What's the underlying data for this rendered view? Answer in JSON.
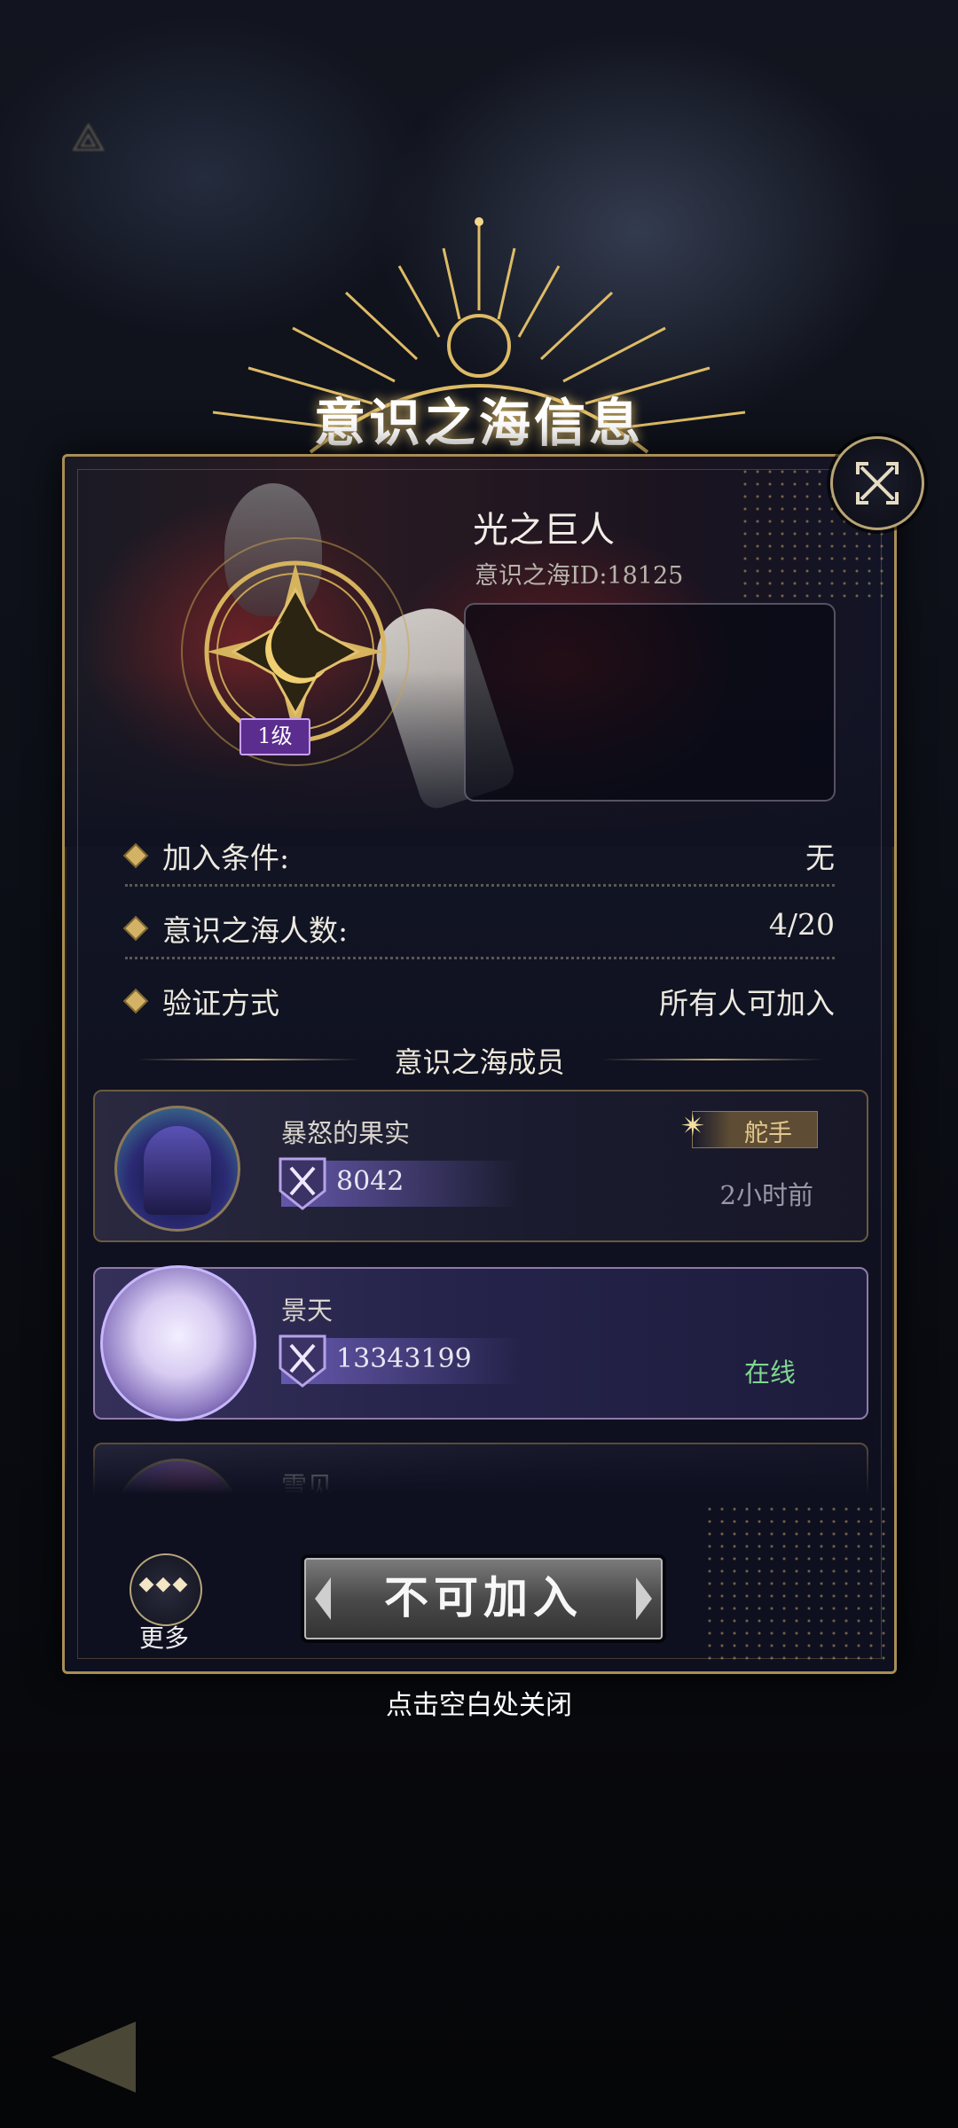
{
  "background": {
    "title_text": ""
  },
  "panel": {
    "title": "意识之海信息",
    "sea_name": "光之巨人",
    "sea_id": "意识之海ID:18125",
    "level_badge": "1级",
    "info": [
      {
        "label": "加入条件:",
        "value": "无"
      },
      {
        "label": "意识之海人数:",
        "value": "4/20"
      },
      {
        "label": "验证方式",
        "value": "所有人可加入"
      }
    ],
    "members_section_title": "意识之海成员",
    "members": [
      {
        "name": "暴怒的果实",
        "power": "8042",
        "status": "2小时前",
        "role": "舵手"
      },
      {
        "name": "景天",
        "power": "13343199",
        "status": "在线"
      },
      {
        "name": "雪见"
      }
    ],
    "more_label": "更多",
    "join_button": "不可加入",
    "tap_to_close": "点击空白处关闭"
  },
  "colors": {
    "accent_gold": "#d4b265",
    "online_green": "#7fd68f",
    "level_purple": "#5b2d8e"
  },
  "icons": [
    "close-icon",
    "crossed-swords-icon",
    "sun-emblem-icon",
    "back-arrow-icon",
    "more-dots-icon"
  ]
}
